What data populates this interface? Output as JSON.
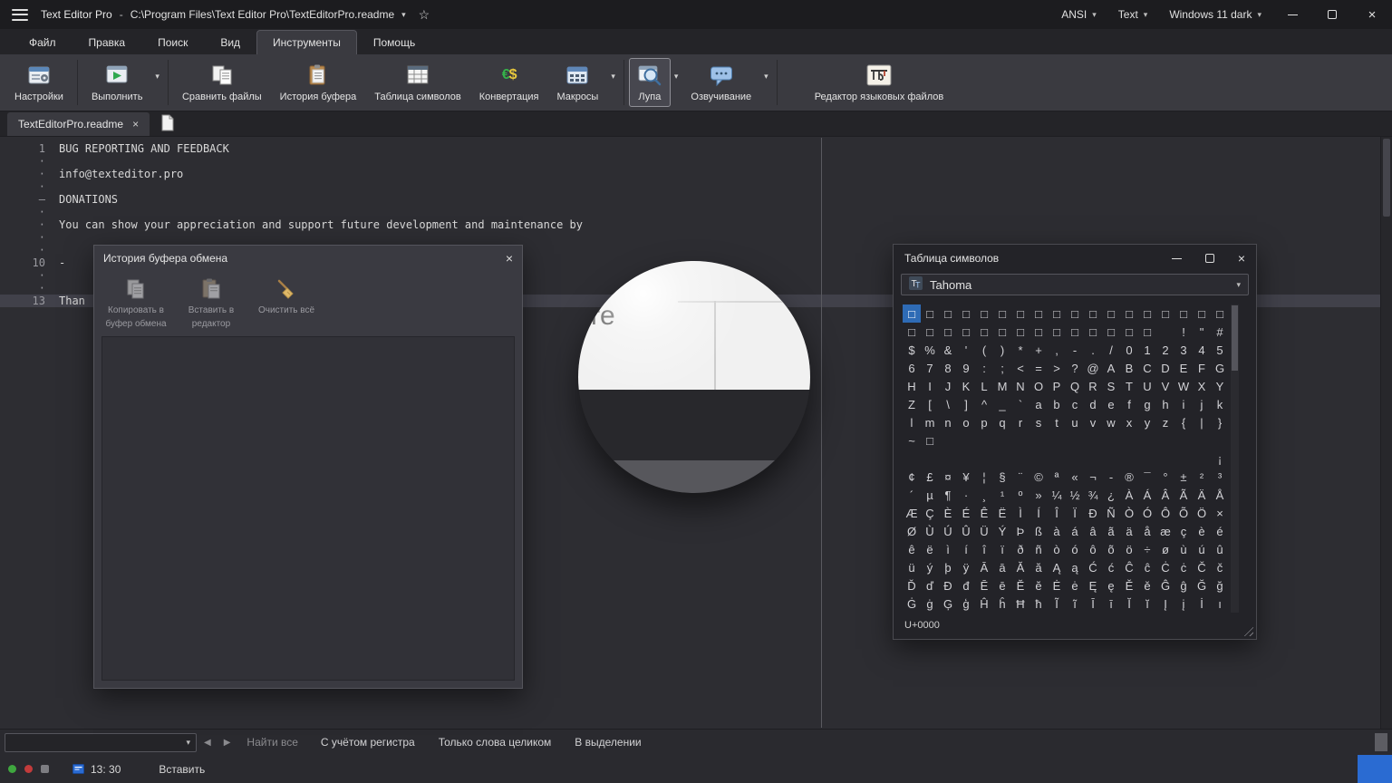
{
  "titlebar": {
    "app_title": "Text Editor Pro",
    "title_separator": "-",
    "file_path": "C:\\Program Files\\Text Editor Pro\\TextEditorPro.readme",
    "encoding": "ANSI",
    "doc_type": "Text",
    "theme": "Windows 11 dark"
  },
  "menu": {
    "active_index": 4,
    "items": [
      {
        "id": "file",
        "label": "Файл"
      },
      {
        "id": "edit",
        "label": "Правка"
      },
      {
        "id": "search",
        "label": "Поиск"
      },
      {
        "id": "view",
        "label": "Вид"
      },
      {
        "id": "tools",
        "label": "Инструменты"
      },
      {
        "id": "help",
        "label": "Помощь"
      }
    ]
  },
  "toolbar": {
    "buttons": [
      {
        "id": "settings",
        "label": "Настройки",
        "icon": "settings-icon",
        "dropdown": false,
        "selected": false,
        "sep_after": true
      },
      {
        "id": "run",
        "label": "Выполнить",
        "icon": "run-icon",
        "dropdown": true,
        "selected": false,
        "sep_after": true
      },
      {
        "id": "compare-files",
        "label": "Сравнить файлы",
        "icon": "compare-icon",
        "dropdown": false,
        "selected": false,
        "sep_after": false
      },
      {
        "id": "clipboard-history",
        "label": "История буфера",
        "icon": "clipboard-icon",
        "dropdown": false,
        "selected": false,
        "sep_after": false
      },
      {
        "id": "char-table",
        "label": "Таблица символов",
        "icon": "chartable-icon",
        "dropdown": false,
        "selected": false,
        "sep_after": false
      },
      {
        "id": "convert",
        "label": "Конвертация",
        "icon": "convert-icon",
        "dropdown": false,
        "selected": false,
        "sep_after": false
      },
      {
        "id": "macros",
        "label": "Макросы",
        "icon": "macros-icon",
        "dropdown": true,
        "selected": false,
        "sep_after": true
      },
      {
        "id": "magnifier",
        "label": "Лупа",
        "icon": "magnifier-icon",
        "dropdown": true,
        "selected": true,
        "sep_after": false
      },
      {
        "id": "speech",
        "label": "Озвучивание",
        "icon": "speech-icon",
        "dropdown": true,
        "selected": false,
        "sep_after": true
      },
      {
        "id": "language-editor",
        "label": "Редактор языковых файлов",
        "icon": "language-icon",
        "dropdown": false,
        "selected": false,
        "sep_after": false
      }
    ]
  },
  "doc_tabs": {
    "active_title": "TextEditorPro.readme"
  },
  "editor": {
    "lines": [
      {
        "gutter": "1",
        "text": "BUG REPORTING AND FEEDBACK",
        "current": false
      },
      {
        "gutter": "·",
        "text": "",
        "current": false
      },
      {
        "gutter": "·",
        "text": "info@texteditor.pro",
        "current": false
      },
      {
        "gutter": "·",
        "text": "",
        "current": false
      },
      {
        "gutter": "–",
        "text": "DONATIONS",
        "current": false
      },
      {
        "gutter": "·",
        "text": "",
        "current": false
      },
      {
        "gutter": "·",
        "text": "You can show your appreciation and support future development and maintenance by",
        "current": false
      },
      {
        "gutter": "·",
        "text": "",
        "current": false
      },
      {
        "gutter": "·",
        "text": "",
        "current": false
      },
      {
        "gutter": "10",
        "text": "-",
        "current": false
      },
      {
        "gutter": "·",
        "text": "",
        "current": false
      },
      {
        "gutter": "·",
        "text": "",
        "current": false
      },
      {
        "gutter": "13",
        "text": "Than",
        "current": true
      }
    ]
  },
  "magnifier": {
    "sample_text": "re"
  },
  "clipboard_window": {
    "title": "История буфера обмена",
    "buttons": [
      {
        "id": "copy-to-clipboard",
        "label_line1": "Копировать в",
        "label_line2": "буфер обмена",
        "icon": "copy-icon",
        "enabled": false
      },
      {
        "id": "paste-to-editor",
        "label_line1": "Вставить в",
        "label_line2": "редактор",
        "icon": "paste-icon",
        "enabled": false
      },
      {
        "id": "clear-all",
        "label_line1": "Очистить всё",
        "label_line2": "",
        "icon": "broom-icon",
        "enabled": true
      }
    ]
  },
  "char_table": {
    "title": "Таблица символов",
    "font_name": "Tahoma",
    "status": "U+0000",
    "selected_cell": {
      "row": 0,
      "col": 0
    },
    "grid_rows": [
      "□□□□□□□□□□□□□□□□□□",
      "□□□□□□□□□□□□□□ !\"#",
      "$%&'()*+,-./012345",
      "6789:;<=>?@ABCDEFG",
      "HIJKLMNOPQRSTUVWXY",
      "Z[\\]^_`abcdefghijk",
      "lmnopqrstuvwxyz{|}",
      "~□                ",
      "                 ¡",
      "¢£¤¥¦§¨©ª«¬-®¯°±²³",
      "´µ¶·¸¹º»¼½¾¿ÀÁÂÃÄÅ",
      "ÆÇÈÉÊËÌÍÎÏÐÑÒÓÔÕÖ×",
      "ØÙÚÛÜÝÞßàáâãäåæçèé",
      "êëìíîïðñòóôõö÷øùúû",
      "üýþÿĀāĂăĄąĆćĈĉĊċČč",
      "ĎďĐđĒēĔĕĖėĘęĚěĜĝĞğ",
      "ĠġĢģĤĥĦħĨĩĪīĬĭĮįİı"
    ]
  },
  "search_bar": {
    "find_all_label": "Найти все",
    "options": [
      {
        "id": "match-case",
        "label": "С учётом регистра"
      },
      {
        "id": "whole-words",
        "label": "Только слова целиком"
      },
      {
        "id": "in-selection",
        "label": "В выделении"
      }
    ]
  },
  "status_bar": {
    "position": "13: 30",
    "mode": "Вставить"
  },
  "colors": {
    "accent_blue": "#2a6bd2",
    "selection_blue": "#2e6bb5",
    "status_green": "#3fa73f",
    "status_red": "#c23b3b"
  }
}
